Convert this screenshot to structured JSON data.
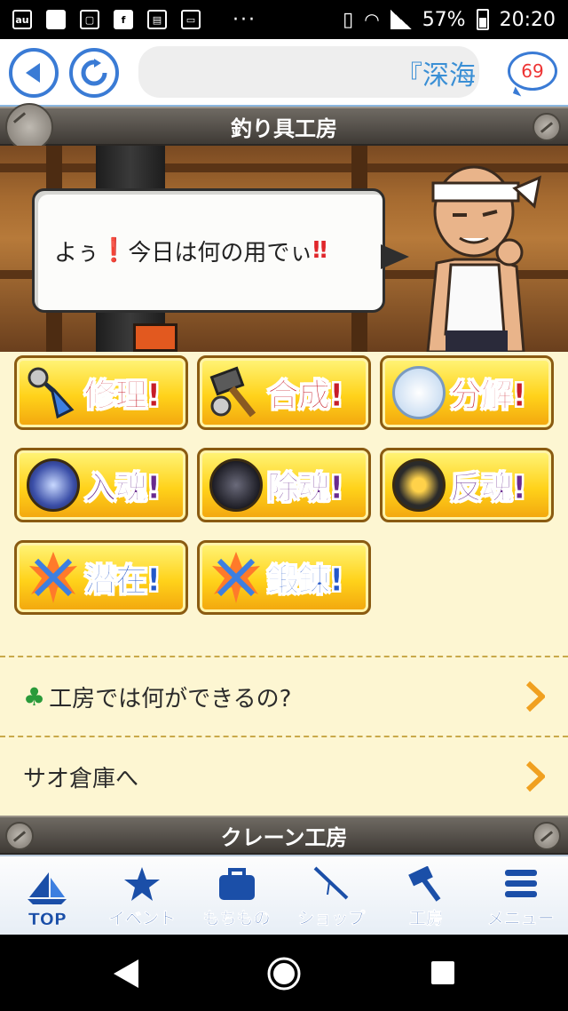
{
  "status_bar": {
    "battery": "57%",
    "time": "20:20",
    "dots": "···",
    "left_icons": [
      "au-icon",
      "square-icon",
      "phone-icon",
      "facebook-icon",
      "market-icon",
      "pass-icon"
    ]
  },
  "browser": {
    "url_text": "『深海",
    "notification_count": "69"
  },
  "workshop": {
    "title": "釣り具工房",
    "speech_prefix": "よぅ",
    "speech_exclaim1": "❗",
    "speech_middle": " 今日は何の用でぃ",
    "speech_exclaim2": "‼"
  },
  "actions": [
    {
      "label": "修理!",
      "icon": "wrench-icon"
    },
    {
      "label": "合成!",
      "icon": "hammer-icon"
    },
    {
      "label": "分解!",
      "icon": "soul-orb-white-icon"
    },
    {
      "label": "入魂!",
      "icon": "soul-orb-blue-icon"
    },
    {
      "label": "除魂!",
      "icon": "soul-orb-dark-icon"
    },
    {
      "label": "反魂!",
      "icon": "soul-orb-gold-icon"
    },
    {
      "label": "潜在!",
      "icon": "crossed-swords-icon"
    },
    {
      "label": "鍛錬!",
      "icon": "crossed-swords-icon"
    }
  ],
  "links": [
    {
      "label": "工房では何ができるの?",
      "icon": "clover-icon"
    },
    {
      "label": "サオ倉庫へ"
    }
  ],
  "next_section": {
    "title": "クレーン工房"
  },
  "tabs": [
    {
      "label": "TOP",
      "icon": "sailboat-icon"
    },
    {
      "label": "イベント",
      "icon": "star-icon"
    },
    {
      "label": "もちもの",
      "icon": "bag-icon"
    },
    {
      "label": "ショップ",
      "icon": "fishing-rod-icon"
    },
    {
      "label": "工房",
      "icon": "hammer-icon"
    },
    {
      "label": "メニュー",
      "icon": "menu-icon"
    }
  ],
  "colors": {
    "accent_blue": "#3a7bd5",
    "button_gold": "#ffd21a",
    "label_red": "#c71d28",
    "label_purple": "#6a2b8f",
    "content_bg": "#fdf6d2"
  }
}
